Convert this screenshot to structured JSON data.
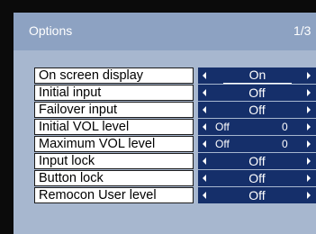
{
  "header": {
    "title": "Options",
    "page": "1/3"
  },
  "rows": [
    {
      "label": "On screen display",
      "value": "On"
    },
    {
      "label": "Initial input",
      "value": "Off"
    },
    {
      "label": "Failover input",
      "value": "Off"
    },
    {
      "label": "Initial VOL level",
      "value": "Off",
      "number": "0"
    },
    {
      "label": "Maximum VOL level",
      "value": "Off",
      "number": "0"
    },
    {
      "label": "Input lock",
      "value": "Off"
    },
    {
      "label": "Button lock",
      "value": "Off"
    },
    {
      "label": "Remocon User level",
      "value": "Off"
    }
  ],
  "colors": {
    "header_bg": "#8da2c2",
    "panel_bg": "#a7b7cf",
    "selector_bg": "#152f6a"
  },
  "icons": {
    "left": "arrow-left-icon",
    "right": "arrow-right-icon"
  }
}
